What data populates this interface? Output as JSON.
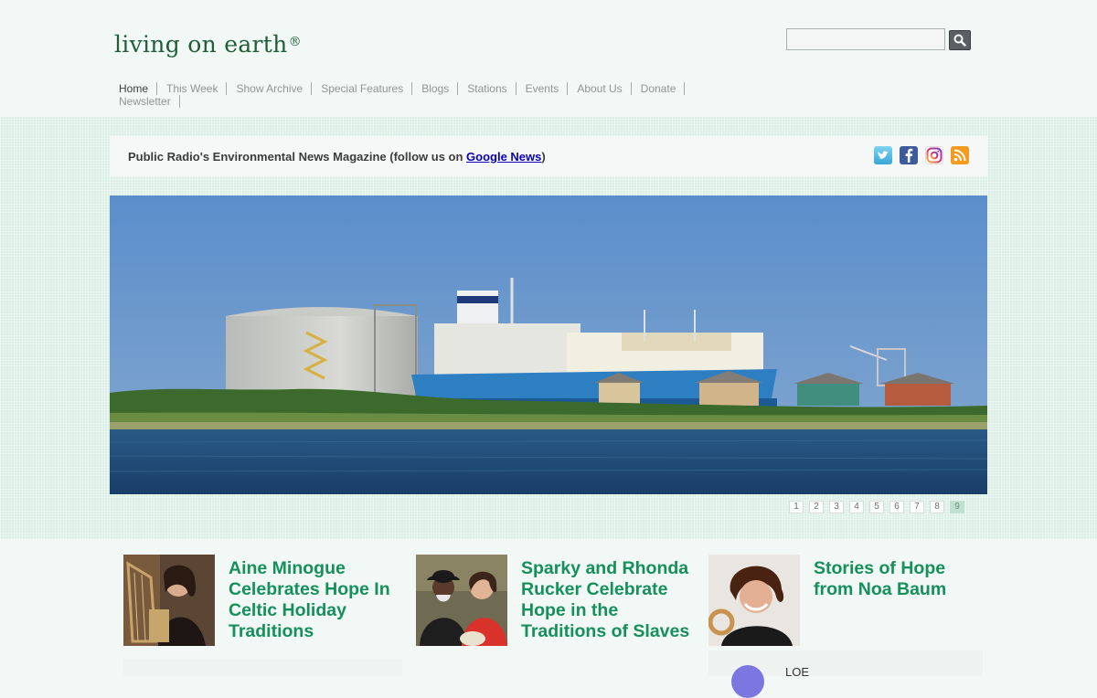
{
  "header": {
    "logo_text": "living on earth",
    "logo_mark": "®",
    "search": {
      "value": "",
      "placeholder": ""
    }
  },
  "nav": {
    "items": [
      {
        "label": "Home",
        "active": true
      },
      {
        "label": "This Week"
      },
      {
        "label": "Show Archive"
      },
      {
        "label": "Special Features"
      },
      {
        "label": "Blogs"
      },
      {
        "label": "Stations"
      },
      {
        "label": "Events"
      },
      {
        "label": "About Us"
      },
      {
        "label": "Donate"
      },
      {
        "label": "Newsletter"
      }
    ]
  },
  "tagline": {
    "prefix": "Public Radio's Environmental News Magazine (follow us on ",
    "link": "Google News",
    "suffix": ")"
  },
  "socials": [
    {
      "icon": "twitter-icon"
    },
    {
      "icon": "facebook-icon"
    },
    {
      "icon": "instagram-icon"
    },
    {
      "icon": "rss-icon"
    }
  ],
  "pager": {
    "pages": [
      "1",
      "2",
      "3",
      "4",
      "5",
      "6",
      "7",
      "8",
      "9"
    ],
    "active": "9"
  },
  "articles": [
    {
      "title": "Aine Minogue Celebrates Hope In Celtic Holiday Traditions"
    },
    {
      "title": "Sparky and Rhonda Rucker Celebrate Hope in the Traditions of Slaves"
    },
    {
      "title": "Stories of Hope from Noa Baum"
    }
  ],
  "widget": {
    "label": "LOE"
  },
  "colors": {
    "logo_green": "#1f5e36",
    "title_green": "#15905a",
    "band_mint": "#dcefe7",
    "link_blue": "#0a00b5"
  }
}
